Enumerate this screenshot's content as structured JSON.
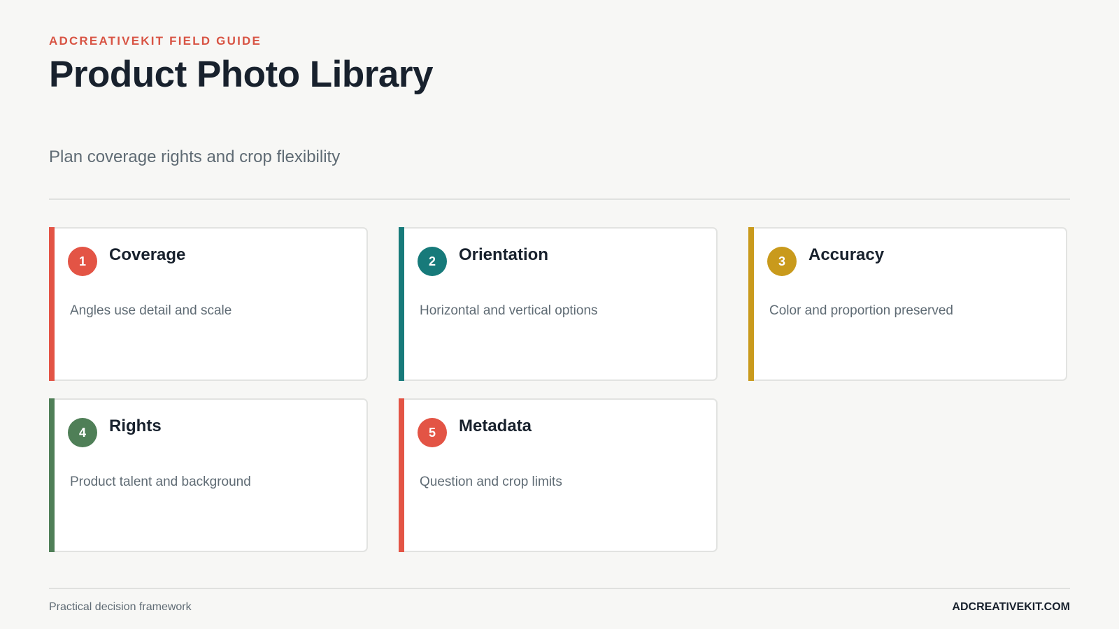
{
  "header": {
    "eyebrow": "ADCREATIVEKIT FIELD GUIDE",
    "title": "Product Photo Library",
    "subtitle": "Plan coverage rights and crop flexibility"
  },
  "colors": {
    "coral": "#e35445",
    "teal": "#177a7a",
    "gold": "#c99a1c",
    "green": "#4f7f57"
  },
  "cards": [
    {
      "number": "1",
      "title": "Coverage",
      "description": "Angles use detail and scale",
      "accent": "#e35445"
    },
    {
      "number": "2",
      "title": "Orientation",
      "description": "Horizontal and vertical options",
      "accent": "#177a7a"
    },
    {
      "number": "3",
      "title": "Accuracy",
      "description": "Color and proportion preserved",
      "accent": "#c99a1c"
    },
    {
      "number": "4",
      "title": "Rights",
      "description": "Product talent and background",
      "accent": "#4f7f57"
    },
    {
      "number": "5",
      "title": "Metadata",
      "description": "Question and crop limits",
      "accent": "#e35445"
    }
  ],
  "footer": {
    "left": "Practical decision framework",
    "right": "ADCREATIVEKIT.COM"
  }
}
